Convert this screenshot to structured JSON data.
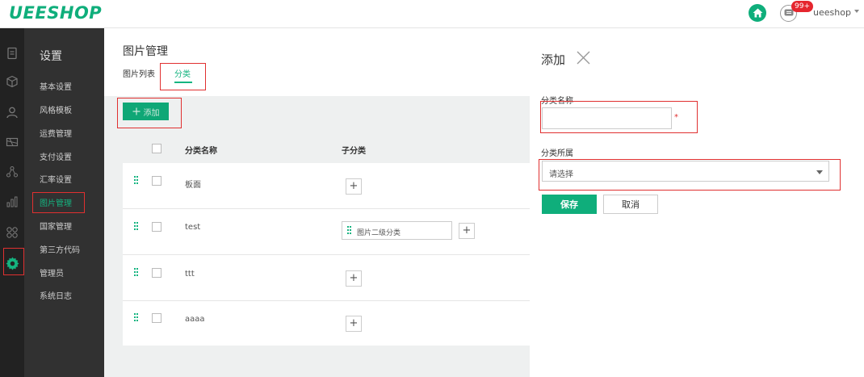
{
  "header": {
    "logo": "UEESHOP",
    "notification_badge": "99+",
    "username": "ueeshop"
  },
  "rail": {
    "icons": [
      "document-icon",
      "box-icon",
      "user-icon",
      "shipping-icon",
      "network-icon",
      "chart-icon",
      "apps-icon",
      "gear-icon"
    ],
    "active_icon": "gear-icon"
  },
  "sidebar": {
    "title": "设置",
    "items": [
      "基本设置",
      "风格模板",
      "运费管理",
      "支付设置",
      "汇率设置",
      "图片管理",
      "国家管理",
      "第三方代码",
      "管理员",
      "系统日志"
    ],
    "active_item": "图片管理"
  },
  "main": {
    "title": "图片管理",
    "tabs": [
      "图片列表",
      "分类"
    ],
    "active_tab": "分类",
    "add_button": "添加",
    "table": {
      "columns": [
        "分类名称",
        "子分类"
      ],
      "rows": [
        {
          "name": "板面",
          "children": []
        },
        {
          "name": "test",
          "children": [
            "图片二级分类"
          ]
        },
        {
          "name": "ttt",
          "children": []
        },
        {
          "name": "aaaa",
          "children": []
        }
      ]
    }
  },
  "panel": {
    "title": "添加",
    "fields": {
      "name_label": "分类名称",
      "name_value": "",
      "required_mark": "*",
      "parent_label": "分类所属",
      "parent_value": "请选择"
    },
    "save_button": "保存",
    "cancel_button": "取消"
  },
  "colors": {
    "brand_green": "#0fae7b",
    "badge_red": "#e5262e",
    "highlight_red": "#e03030"
  }
}
